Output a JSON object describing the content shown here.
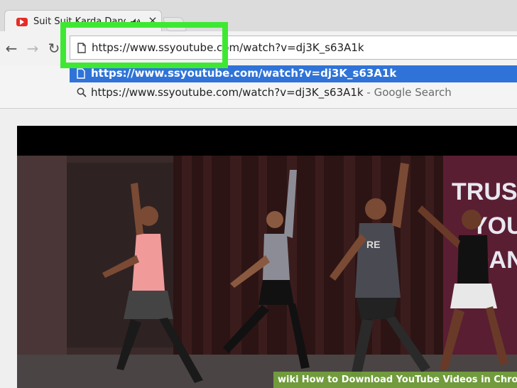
{
  "tab": {
    "title": "Suit Suit Karda Dance",
    "favicon": "youtube-icon",
    "audio_icon": "speaker-icon",
    "close": "×"
  },
  "toolbar": {
    "back": "←",
    "forward": "→",
    "reload": "↻",
    "omnibox_value": "https://www.ssyoutube.com/watch?v=dj3K_s63A1k"
  },
  "suggestions": [
    {
      "icon": "page-icon",
      "text": "https://www.ssyoutube.com/watch?v=dj3K_s63A1k",
      "hint": ""
    },
    {
      "icon": "search-icon",
      "text": "https://www.ssyoutube.com/watch?v=dj3K_s63A1k",
      "hint": " - Google Search"
    }
  ],
  "video": {
    "banner_text": "TRUS\nYOU\nDAN"
  },
  "watermark": {
    "brand": "wiki",
    "caption": "How to Download YouTube Videos in Chrome"
  },
  "colors": {
    "highlight": "#3ee832",
    "selection": "#2f73d8",
    "youtube_red": "#e52d27"
  }
}
